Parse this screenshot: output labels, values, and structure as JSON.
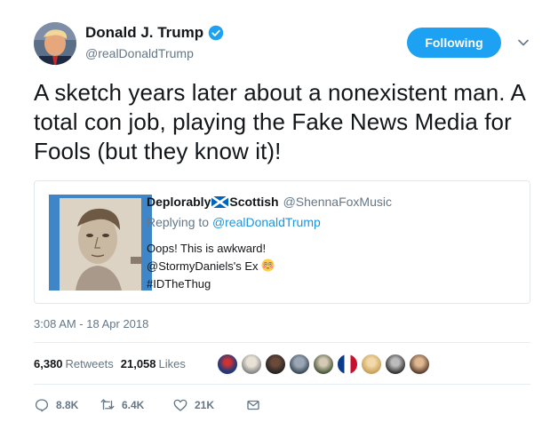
{
  "author": {
    "name": "Donald J. Trump",
    "handle": "@realDonaldTrump",
    "follow_label": "Following"
  },
  "tweet": {
    "text": "A sketch years later about a nonexistent man. A total con job, playing the Fake News Media for Fools (but they know it)!",
    "timestamp": "3:08 AM - 18 Apr 2018"
  },
  "quoted": {
    "name_part1": "Deplorably",
    "name_part2": "Scottish",
    "handle": "@ShennaFoxMusic",
    "reply_prefix": "Replying to",
    "reply_to": "@realDonaldTrump",
    "line1": "Oops! This is awkward!",
    "line2": "@StormyDaniels's Ex",
    "line3": "#IDTheThug"
  },
  "stats": {
    "retweets_count": "6,380",
    "retweets_label": "Retweets",
    "likes_count": "21,058",
    "likes_label": "Likes"
  },
  "actions": {
    "replies": "8.8K",
    "retweets": "6.4K",
    "likes": "21K"
  },
  "colors": {
    "accent": "#1da1f2",
    "link": "#1b95e0",
    "muted": "#657786"
  }
}
